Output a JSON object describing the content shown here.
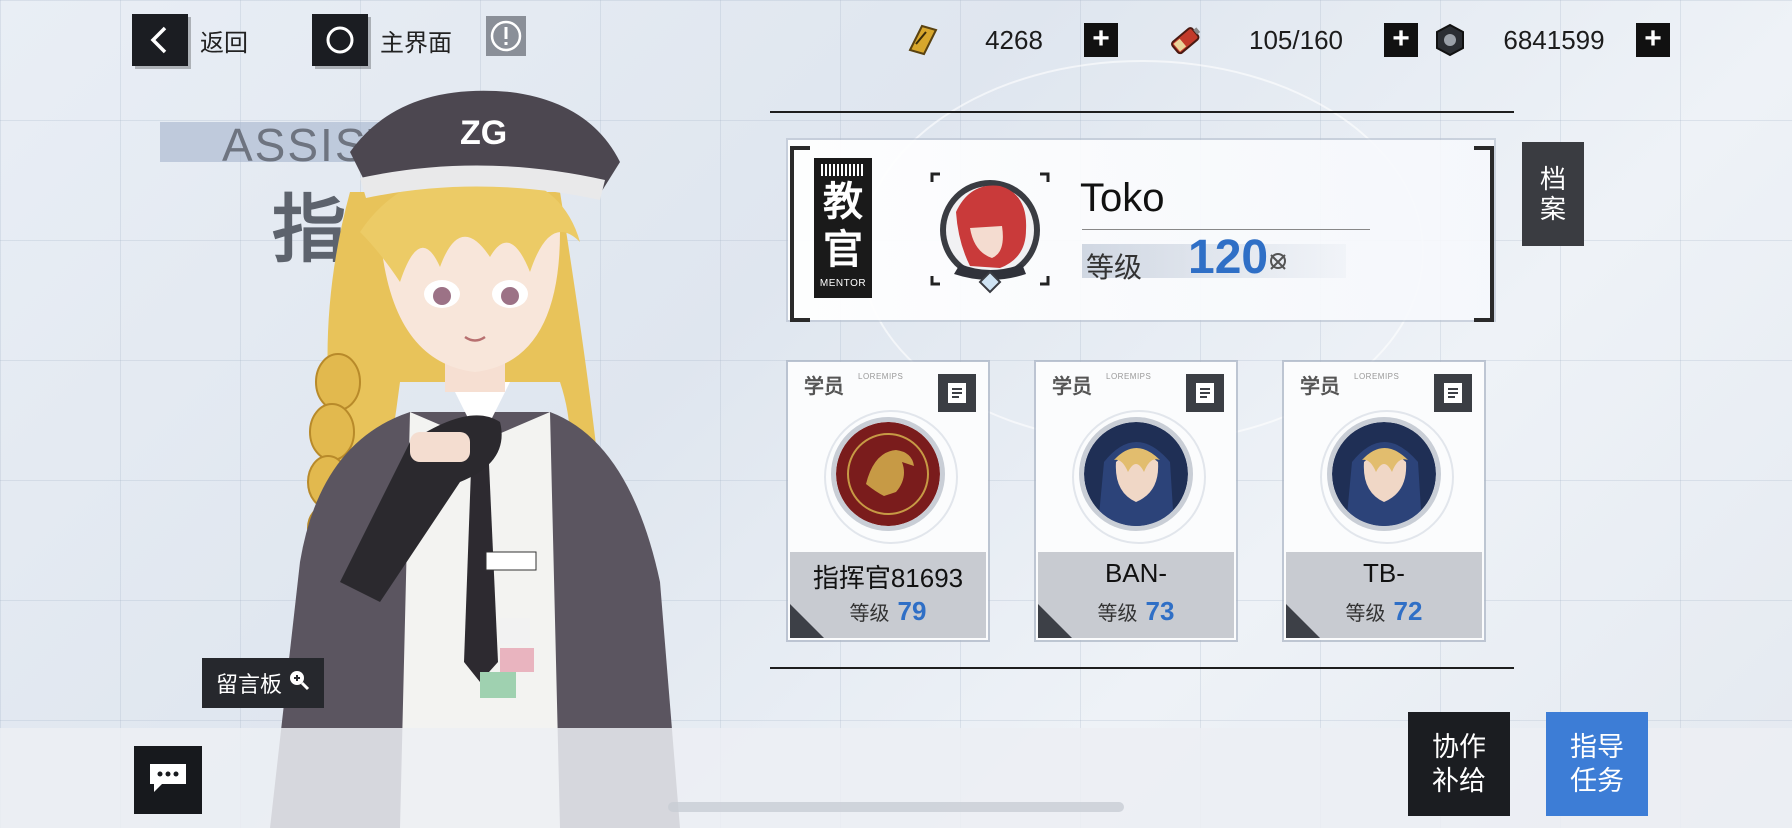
{
  "topbar": {
    "back_label": "返回",
    "home_label": "主界面",
    "resources": [
      {
        "icon": "gold-bar-icon",
        "value": "4268"
      },
      {
        "icon": "battery-icon",
        "value": "105/160"
      },
      {
        "icon": "nut-icon",
        "value": "6841599"
      }
    ]
  },
  "assist": {
    "en": "ASSIST",
    "cn": "指导"
  },
  "board_button": "留言板",
  "mentor": {
    "tag_cn_1": "教",
    "tag_cn_2": "官",
    "tag_en": "MENTOR",
    "name": "Toko",
    "level_label": "等级",
    "level": "120"
  },
  "archive_button": {
    "line1": "档",
    "line2": "案"
  },
  "students": [
    {
      "label": "学员",
      "sub": "LOREMIPS",
      "name": "指挥官81693",
      "level_label": "等级",
      "level": "79",
      "avatar": "emblem"
    },
    {
      "label": "学员",
      "sub": "LOREMIPS",
      "name": "BAN-",
      "level_label": "等级",
      "level": "73",
      "avatar": "hooded"
    },
    {
      "label": "学员",
      "sub": "LOREMIPS",
      "name": "TB-",
      "level_label": "等级",
      "level": "72",
      "avatar": "hooded"
    }
  ],
  "bottom": {
    "coop_line1": "协作",
    "coop_line2": "补给",
    "guide_line1": "指导",
    "guide_line2": "任务"
  },
  "colors": {
    "accent_blue": "#2f6fc6",
    "guide_button": "#3d7dd6",
    "dark": "#1b1d21"
  }
}
